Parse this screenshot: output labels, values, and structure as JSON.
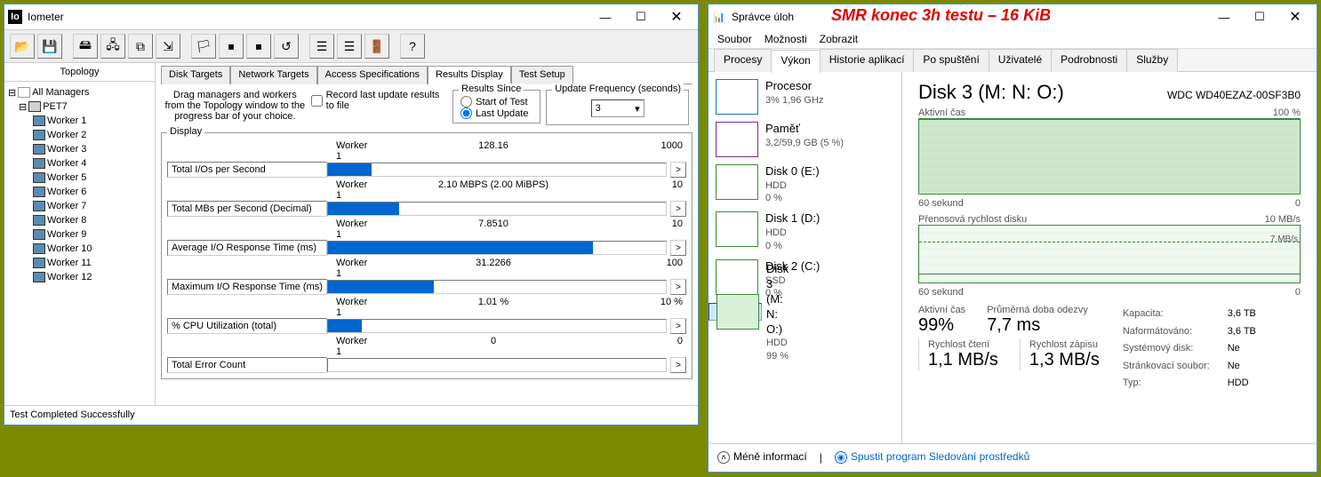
{
  "annotation": "SMR   konec 3h testu – 16 KiB",
  "iometer": {
    "title": "Iometer",
    "toolbar_icons": [
      "folder-open-icon",
      "save-icon",
      "new-disk-icon",
      "new-net-icon",
      "duplicate-icon",
      "spread-icon",
      "flag-start-icon",
      "stop-icon",
      "stop-all-icon",
      "reset-icon",
      "left-align-icon",
      "right-align-icon",
      "exit-icon",
      "help-icon"
    ],
    "topology_header": "Topology",
    "tree": {
      "root": "All Managers",
      "host": "PET7",
      "workers": [
        "Worker 1",
        "Worker 2",
        "Worker 3",
        "Worker 4",
        "Worker 5",
        "Worker 6",
        "Worker 7",
        "Worker 8",
        "Worker 9",
        "Worker 10",
        "Worker 11",
        "Worker 12"
      ]
    },
    "tabs": [
      "Disk Targets",
      "Network Targets",
      "Access Specifications",
      "Results Display",
      "Test Setup"
    ],
    "active_tab": 3,
    "hint": "Drag managers and workers from the Topology window to the progress bar of your choice.",
    "record_checkbox": "Record last update results to file",
    "results_since": {
      "legend": "Results Since",
      "opt1": "Start of Test",
      "opt2": "Last Update",
      "selected": 1
    },
    "update_freq": {
      "legend": "Update Frequency (seconds)",
      "value": "3"
    },
    "display_legend": "Display",
    "metrics": [
      {
        "name": "Worker 1",
        "metric": "Total I/Os per Second",
        "value": "128.16",
        "max": "1000",
        "fill": 12.8
      },
      {
        "name": "Worker 1",
        "metric": "Total MBs per Second (Decimal)",
        "value": "2.10 MBPS (2.00 MiBPS)",
        "max": "10",
        "fill": 21
      },
      {
        "name": "Worker 1",
        "metric": "Average I/O Response Time (ms)",
        "value": "7.8510",
        "max": "10",
        "fill": 78.5
      },
      {
        "name": "Worker 1",
        "metric": "Maximum I/O Response Time (ms)",
        "value": "31.2266",
        "max": "100",
        "fill": 31.2
      },
      {
        "name": "Worker 1",
        "metric": "% CPU Utilization (total)",
        "value": "1.01 %",
        "max": "10 %",
        "fill": 10.1
      },
      {
        "name": "Worker 1",
        "metric": "Total Error Count",
        "value": "0",
        "max": "0",
        "fill": 0
      }
    ],
    "status": "Test Completed Successfully"
  },
  "tm": {
    "title": "Správce úloh",
    "menu": [
      "Soubor",
      "Možnosti",
      "Zobrazit"
    ],
    "tabs": [
      "Procesy",
      "Výkon",
      "Historie aplikací",
      "Po spuštění",
      "Uživatelé",
      "Podrobnosti",
      "Služby"
    ],
    "active_tab": 1,
    "side": [
      {
        "k": "cpu",
        "t1": "Procesor",
        "t2": "3% 1,96 GHz"
      },
      {
        "k": "mem",
        "t1": "Paměť",
        "t2": "3,2/59,9 GB (5 %)"
      },
      {
        "k": "d0",
        "t1": "Disk 0 (E:)",
        "t2": "HDD",
        "t3": "0 %"
      },
      {
        "k": "d1",
        "t1": "Disk 1 (D:)",
        "t2": "HDD",
        "t3": "0 %"
      },
      {
        "k": "d2",
        "t1": "Disk 2 (C:)",
        "t2": "SSD",
        "t3": "0 %"
      },
      {
        "k": "d3",
        "t1": "Disk 3 (M: N: O:)",
        "t2": "HDD",
        "t3": "99 %",
        "sel": true
      }
    ],
    "detail": {
      "heading": "Disk 3 (M: N: O:)",
      "model": "WDC WD40EZAZ-00SF3B0",
      "chart1": {
        "label": "Aktivní čas",
        "right": "100 %",
        "xl": "60 sekund",
        "xr": "0"
      },
      "chart2": {
        "label": "Přenosová rychlost disku",
        "right": "10 MB/s",
        "dashed": "7 MB/s",
        "xl": "60 sekund",
        "xr": "0"
      },
      "stats": {
        "active": {
          "lab": "Aktivní čas",
          "val": "99%"
        },
        "resp": {
          "lab": "Průměrná doba odezvy",
          "val": "7,7 ms"
        },
        "read": {
          "lab": "Rychlost čtení",
          "val": "1,1 MB/s"
        },
        "write": {
          "lab": "Rychlost zápisu",
          "val": "1,3 MB/s"
        }
      },
      "props": [
        [
          "Kapacita:",
          "3,6 TB"
        ],
        [
          "Naformátováno:",
          "3,6 TB"
        ],
        [
          "Systémový disk:",
          "Ne"
        ],
        [
          "Stránkovací soubor:",
          "Ne"
        ],
        [
          "Typ:",
          "HDD"
        ]
      ]
    },
    "footer": {
      "less": "Méně informací",
      "link": "Spustit program Sledování prostředků"
    }
  },
  "chart_data": [
    {
      "type": "area",
      "title": "Aktivní čas",
      "ylim": [
        0,
        100
      ],
      "ylabel": "%",
      "x_range_seconds": 60,
      "series": [
        {
          "name": "Aktivní čas",
          "approx_constant_value": 100
        }
      ]
    },
    {
      "type": "line",
      "title": "Přenosová rychlost disku",
      "ylim": [
        0,
        10
      ],
      "ylabel": "MB/s",
      "x_range_seconds": 60,
      "reference_line": 7,
      "series": [
        {
          "name": "Přenosová rychlost",
          "approx_value": 1.2,
          "note": "low noisy line near bottom"
        }
      ]
    }
  ]
}
